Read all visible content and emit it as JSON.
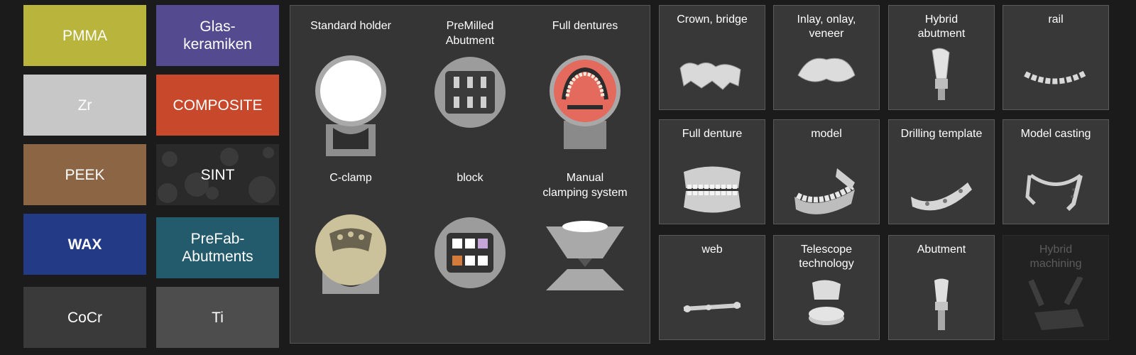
{
  "materials": [
    {
      "label": "PMMA",
      "color": "#b8b43c"
    },
    {
      "label": "Glas-\nkeramiken",
      "color": "#534a8f"
    },
    {
      "label": "Zr",
      "color": "#c7c7c7"
    },
    {
      "label": "COMPOSITE",
      "color": "#c8482b"
    },
    {
      "label": "PEEK",
      "color": "#8c6545"
    },
    {
      "label": "SINT",
      "color": "#2a2a2a"
    },
    {
      "label": "WAX",
      "color": "#233a86"
    },
    {
      "label": "PreFab-\nAbutments",
      "color": "#245b6c"
    },
    {
      "label": "CoCr",
      "color": "#3a3a3a"
    },
    {
      "label": "Ti",
      "color": "#4d4d4d"
    }
  ],
  "holders": [
    {
      "label": "Standard holder",
      "icon": "standard-holder-icon"
    },
    {
      "label": "PreMilled\nAbutment",
      "icon": "premilled-holder-icon"
    },
    {
      "label": "Full dentures",
      "icon": "full-dentures-holder-icon"
    },
    {
      "label": "C-clamp",
      "icon": "c-clamp-icon"
    },
    {
      "label": "block",
      "icon": "block-holder-icon"
    },
    {
      "label": "Manual\nclamping system",
      "icon": "manual-clamp-icon"
    }
  ],
  "indications": [
    {
      "label": "Crown, bridge",
      "icon": "crown-bridge-icon"
    },
    {
      "label": "Inlay, onlay,\nveneer",
      "icon": "inlay-icon"
    },
    {
      "label": "Hybrid\nabutment",
      "icon": "hybrid-abutment-icon"
    },
    {
      "label": "rail",
      "icon": "rail-icon"
    },
    {
      "label": "Full denture",
      "icon": "full-denture-icon"
    },
    {
      "label": "model",
      "icon": "model-icon"
    },
    {
      "label": "Drilling template",
      "icon": "drilling-template-icon"
    },
    {
      "label": "Model casting",
      "icon": "model-casting-icon"
    },
    {
      "label": "web",
      "icon": "web-icon"
    },
    {
      "label": "Telescope\ntechnology",
      "icon": "telescope-icon"
    },
    {
      "label": "Abutment",
      "icon": "abutment-icon"
    },
    {
      "label": "Hybrid\nmachining",
      "icon": "hybrid-machining-icon",
      "disabled": true
    }
  ]
}
